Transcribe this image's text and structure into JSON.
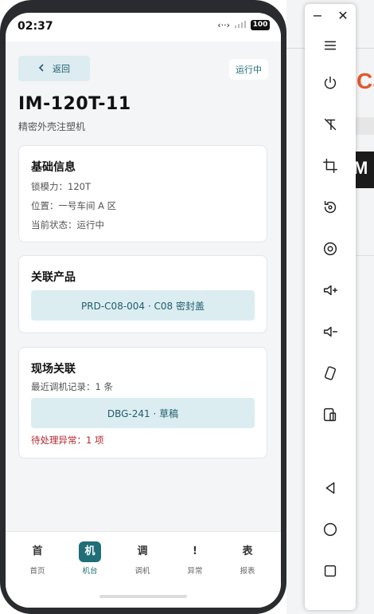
{
  "status_bar": {
    "time": "02:37",
    "signal_text": "‹··›",
    "battery": "100"
  },
  "header": {
    "back_label": "返回",
    "status_chip": "运行中",
    "title": "IM-120T-11",
    "subtitle": "精密外壳注塑机"
  },
  "basic_info": {
    "heading": "基础信息",
    "rows": [
      "锁模力：120T",
      "位置：一号车间 A 区",
      "当前状态：运行中"
    ]
  },
  "related_product": {
    "heading": "关联产品",
    "item": "PRD-C08-004 · C08 密封盖"
  },
  "onsite": {
    "heading": "现场关联",
    "recent_records": "最近调机记录：1 条",
    "record_item": "DBG-241 · 草稿",
    "pending_alert": "待处理异常：1 项"
  },
  "bottom_nav": {
    "items": [
      {
        "glyph": "首",
        "label": "首页"
      },
      {
        "glyph": "机",
        "label": "机台"
      },
      {
        "glyph": "调",
        "label": "调机"
      },
      {
        "glyph": "!",
        "label": "异常"
      },
      {
        "glyph": "表",
        "label": "报表"
      }
    ],
    "active_index": 1
  },
  "background": {
    "brand_fragment": "CS",
    "dark_fragment": "M"
  },
  "colors": {
    "accent": "#1f6e78",
    "accent_light": "#dcedf2",
    "alert": "#b3262b",
    "screen_bg": "#f4f5f7"
  },
  "toolbar": {
    "minimize": "−",
    "close": "✕"
  }
}
